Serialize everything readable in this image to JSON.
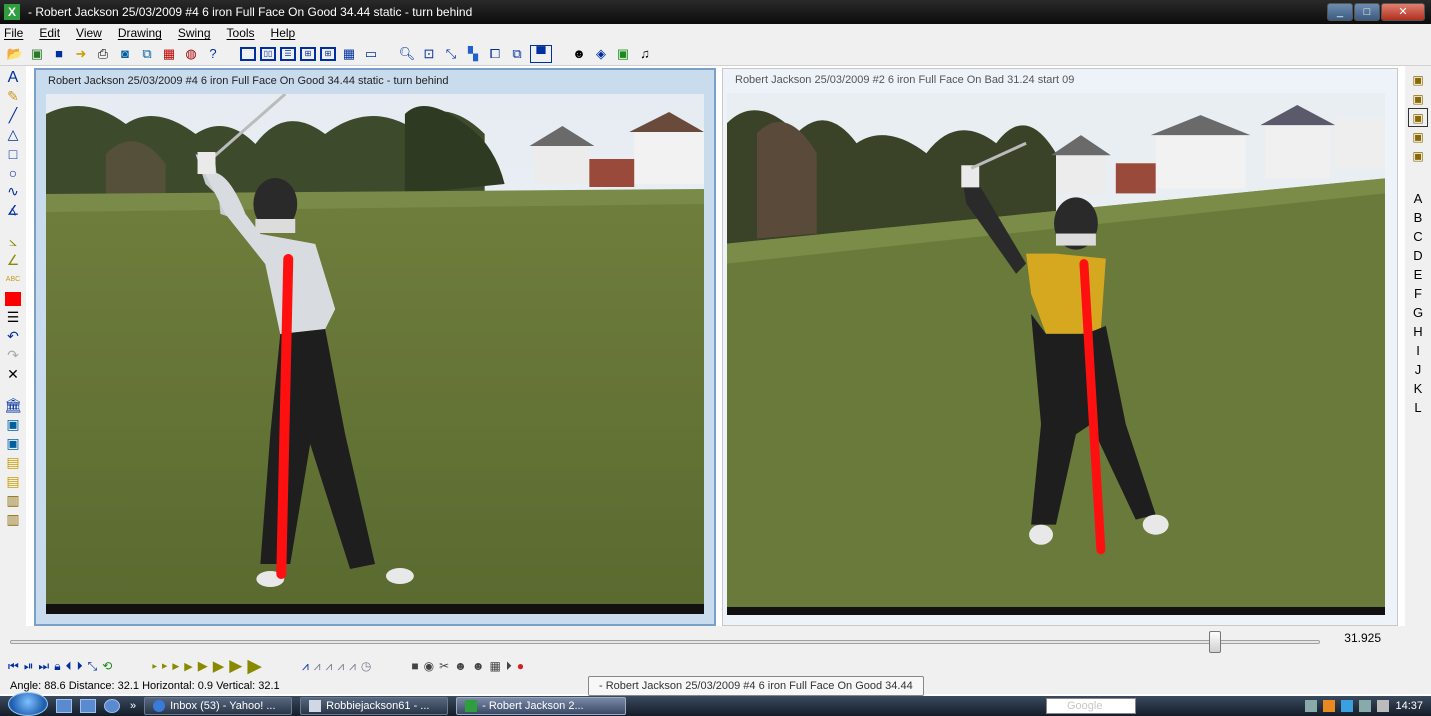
{
  "window": {
    "title": "- Robert Jackson  25/03/2009  #4  6 iron  Full  Face On  Good  34.44  static - turn behind",
    "app_icon": "X",
    "controls": [
      "minimize-icon",
      "maximize-icon",
      "close-icon"
    ]
  },
  "menu": [
    "File",
    "Edit",
    "View",
    "Drawing",
    "Swing",
    "Tools",
    "Help"
  ],
  "toolbar_icons": [
    "open-folder-icon",
    "open-video-icon",
    "save-icon",
    "export-icon",
    "print-icon",
    "camera-icon",
    "copy-icon",
    "film-icon",
    "globe-icon",
    "help-icon",
    "single-view-icon",
    "two-view-icon",
    "horizontal-split-icon",
    "quad-view-icon",
    "grid-view-icon",
    "table-view-icon",
    "monitor-icon",
    "zoom-icon",
    "fit-icon",
    "crop-icon",
    "tiles-icon",
    "compare-icon",
    "overlay-icon",
    "window-icon",
    "user-icon",
    "card-icon",
    "sheet-icon",
    "music-icon"
  ],
  "left_tools": {
    "text_tool": "A",
    "abc_label": "ABC",
    "tools": [
      "text-icon",
      "pencil-icon",
      "line-icon",
      "triangle-icon",
      "rectangle-icon",
      "circle-icon",
      "curve-icon",
      "angle-icon",
      "angle-measure-icon",
      "angle-icon-2",
      "abc-icon",
      "color-swatch-icon",
      "line-width-icon",
      "undo-icon",
      "redo-icon",
      "delete-icon",
      "library-icon",
      "frame-icon-1",
      "frame-icon-2",
      "frame-icon-3",
      "frame-icon-4",
      "frame-icon-5",
      "frame-icon-6"
    ],
    "color": "#ff0000"
  },
  "right_tools": {
    "icons": [
      "video-slot-icon-1",
      "video-slot-icon-2",
      "video-slot-icon-3",
      "video-slot-icon-4",
      "video-slot-icon-5"
    ],
    "letters": [
      "A",
      "B",
      "C",
      "D",
      "E",
      "F",
      "G",
      "H",
      "I",
      "J",
      "K",
      "L"
    ]
  },
  "panels": {
    "left": {
      "title": "Robert Jackson  25/03/2009  #4  6 iron  Full  Face On  Good  34.44  static - turn behind",
      "shirt_color": "#d8dce0"
    },
    "right": {
      "title": "Robert Jackson  25/03/2009  #2  6 iron  Full  Face On  Bad  31.24  start 09",
      "shirt_color": "#d6a820"
    },
    "line_color": "#ff1010"
  },
  "slider": {
    "value": "31.925",
    "position_fraction": 0.92
  },
  "playback_icons": [
    "skip-start-icon",
    "step-both-icon",
    "skip-end-icon",
    "lock-icon",
    "prev-frame-icon",
    "next-frame-icon",
    "marker-icon",
    "loop-icon",
    "speed-1-icon",
    "speed-2-icon",
    "speed-3-icon",
    "speed-4-icon",
    "speed-5-icon",
    "speed-6-icon",
    "speed-7-icon",
    "speed-8-icon",
    "swing-1-icon",
    "swing-2-icon",
    "swing-3-icon",
    "swing-4-icon",
    "swing-5-icon",
    "clock-icon",
    "record-icon",
    "webcam-icon",
    "cut-icon",
    "figure-1-icon",
    "figure-2-icon",
    "grid-icon",
    "play-circle-icon",
    "color-balls-icon"
  ],
  "status": {
    "text": "Angle: 88.6  Distance: 32.1  Horizontal: 0.9  Vertical: 32.1",
    "tooltip": "- Robert Jackson  25/03/2009  #4  6 iron  Full  Face On  Good  34.44"
  },
  "taskbar": {
    "more": "»",
    "buttons": [
      {
        "label": "Inbox (53) - Yahoo! ...",
        "icon": "ie-icon"
      },
      {
        "label": "Robbiejackson61 - ...",
        "icon": "document-icon"
      },
      {
        "label": "- Robert Jackson  2...",
        "icon": "app-icon",
        "active": true
      }
    ],
    "search_placeholder": "Google",
    "time": "14:37"
  }
}
